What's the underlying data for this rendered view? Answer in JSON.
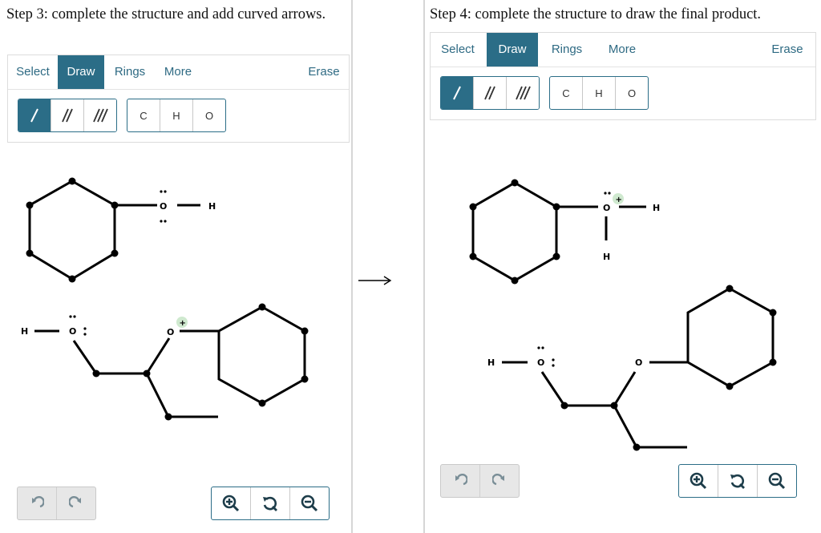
{
  "left": {
    "title": "Step 3: complete the structure and add curved arrows.",
    "tabs": {
      "select": "Select",
      "draw": "Draw",
      "rings": "Rings",
      "more": "More",
      "erase": "Erase"
    },
    "atoms": {
      "c": "C",
      "h": "H",
      "o": "O"
    },
    "molecule": {
      "o_top": "O",
      "h_top": "H",
      "h_left": "H",
      "o_left": "O",
      "o_right": "O",
      "charge": "+"
    }
  },
  "right": {
    "title": "Step 4: complete the structure to draw the final product.",
    "tabs": {
      "select": "Select",
      "draw": "Draw",
      "rings": "Rings",
      "more": "More",
      "erase": "Erase"
    },
    "atoms": {
      "c": "C",
      "h": "H",
      "o": "O"
    },
    "molecule": {
      "o_top": "O",
      "h_top_right": "H",
      "h_top_below": "H",
      "h_left": "H",
      "o_left": "O",
      "o_right": "O",
      "charge": "+"
    }
  },
  "icons": {
    "bond_single": "single-bond-icon",
    "bond_double": "double-bond-icon",
    "bond_triple": "triple-bond-icon",
    "undo": "undo-icon",
    "redo": "redo-icon",
    "zoom_in": "zoom-in-icon",
    "reset": "reset-zoom-icon",
    "zoom_out": "zoom-out-icon",
    "reaction_arrow": "reaction-arrow-icon"
  },
  "colors": {
    "accent": "#2b6d87",
    "charge_bg": "#cfe9cf"
  }
}
